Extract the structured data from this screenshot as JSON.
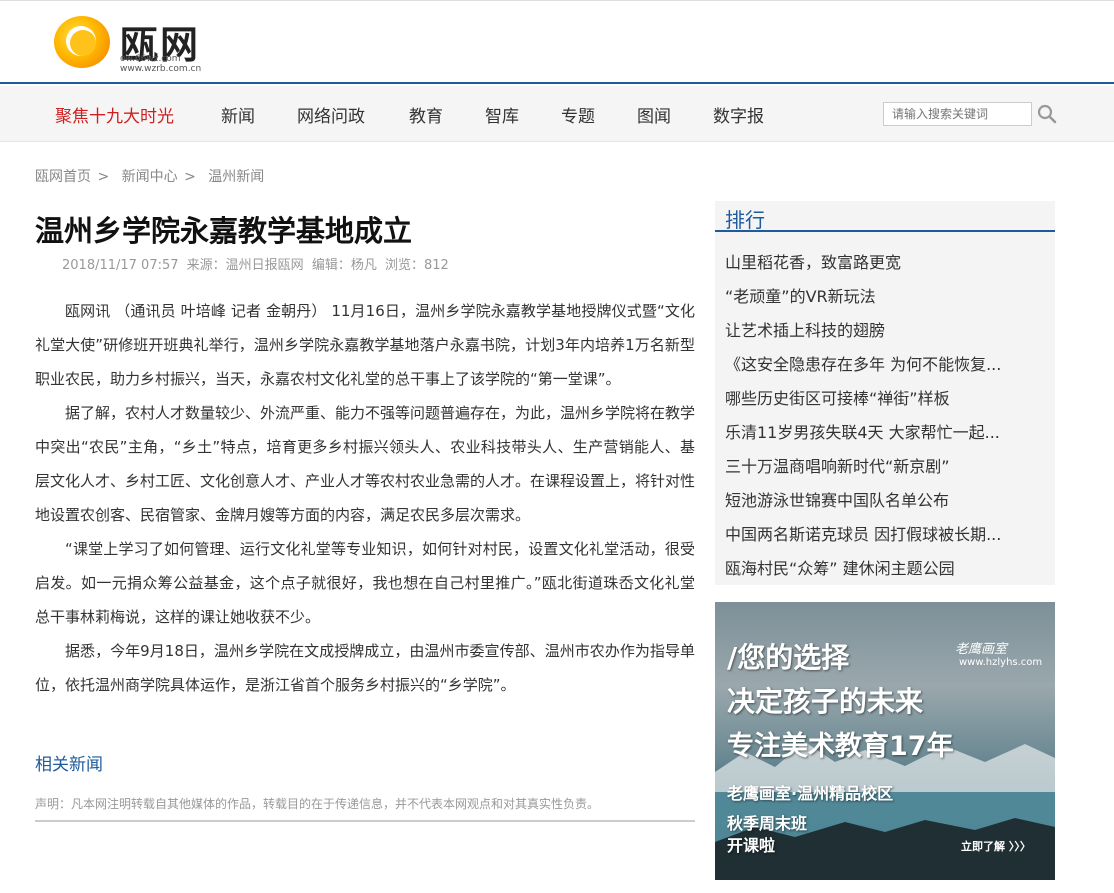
{
  "header": {
    "logo_text": "瓯网",
    "logo_sub1": "ow.66wz.com",
    "logo_sub2": "www.wzrb.com.cn"
  },
  "nav": {
    "items": [
      "聚焦十九大时光",
      "新闻",
      "网络问政",
      "教育",
      "智库",
      "专题",
      "图闻",
      "数字报"
    ],
    "search_placeholder": "请输入搜索关键词"
  },
  "breadcrumb": [
    "瓯网首页",
    "新闻中心",
    "温州新闻"
  ],
  "breadcrumb_sep": ">",
  "article": {
    "title": "温州乡学院永嘉教学基地成立",
    "date": "2018/11/17 07:57",
    "source": "来源：温州日报瓯网",
    "editor": "编辑：杨凡",
    "views": "浏览：812",
    "paragraphs": [
      "瓯网讯 （通讯员 叶培峰 记者 金朝丹） 11月16日，温州乡学院永嘉教学基地授牌仪式暨“文化礼堂大使”研修班开班典礼举行，温州乡学院永嘉教学基地落户永嘉书院，计划3年内培养1万名新型职业农民，助力乡村振兴，当天，永嘉农村文化礼堂的总干事上了该学院的“第一堂课”。",
      "据了解，农村人才数量较少、外流严重、能力不强等问题普遍存在，为此，温州乡学院将在教学中突出“农民”主角，“乡土”特点，培育更多乡村振兴领头人、农业科技带头人、生产营销能人、基层文化人才、乡村工匠、文化创意人才、产业人才等农村农业急需的人才。在课程设置上，将针对性地设置农创客、民宿管家、金牌月嫂等方面的内容，满足农民多层次需求。",
      "“课堂上学习了如何管理、运行文化礼堂等专业知识，如何针对村民，设置文化礼堂活动，很受启发。如一元捐众筹公益基金，这个点子就很好，我也想在自己村里推广。”瓯北街道珠岙文化礼堂总干事林莉梅说，这样的课让她收获不少。",
      "据悉，今年9月18日，温州乡学院在文成授牌成立，由温州市委宣传部、温州市农办作为指导单位，依托温州商学院具体运作，是浙江省首个服务乡村振兴的“乡学院”。"
    ],
    "related_title": "相关新闻",
    "disclaimer": "声明：凡本网注明转载自其他媒体的作品，转载目的在于传递信息，并不代表本网观点和对其真实性负责。"
  },
  "sidebar": {
    "title": "排行",
    "items": [
      "山里稻花香，致富路更宽",
      "“老顽童”的VR新玩法",
      "让艺术插上科技的翅膀",
      "《这安全隐患存在多年 为何不能恢复...",
      "哪些历史街区可接棒“禅街”样板",
      "乐清11岁男孩失联4天 大家帮忙一起...",
      "三十万温商唱响新时代“新京剧”",
      "短池游泳世锦赛中国队名单公布",
      "中国两名斯诺克球员 因打假球被长期...",
      "瓯海村民“众筹” 建休闲主题公园"
    ]
  },
  "ad": {
    "line1": "/您的选择",
    "line2": "决定孩子的未来",
    "line3": "专注美术教育17年",
    "line4": "老鹰画室·温州精品校区",
    "line5": "秋季周末班",
    "line6": "开课啦",
    "brand": "老鹰画室",
    "url": "www.hzlyhs.com",
    "cta": "立即了解 〉〉〉"
  },
  "colors": {
    "brand_blue": "#1d5a9e",
    "highlight_red": "#d01f1f"
  }
}
